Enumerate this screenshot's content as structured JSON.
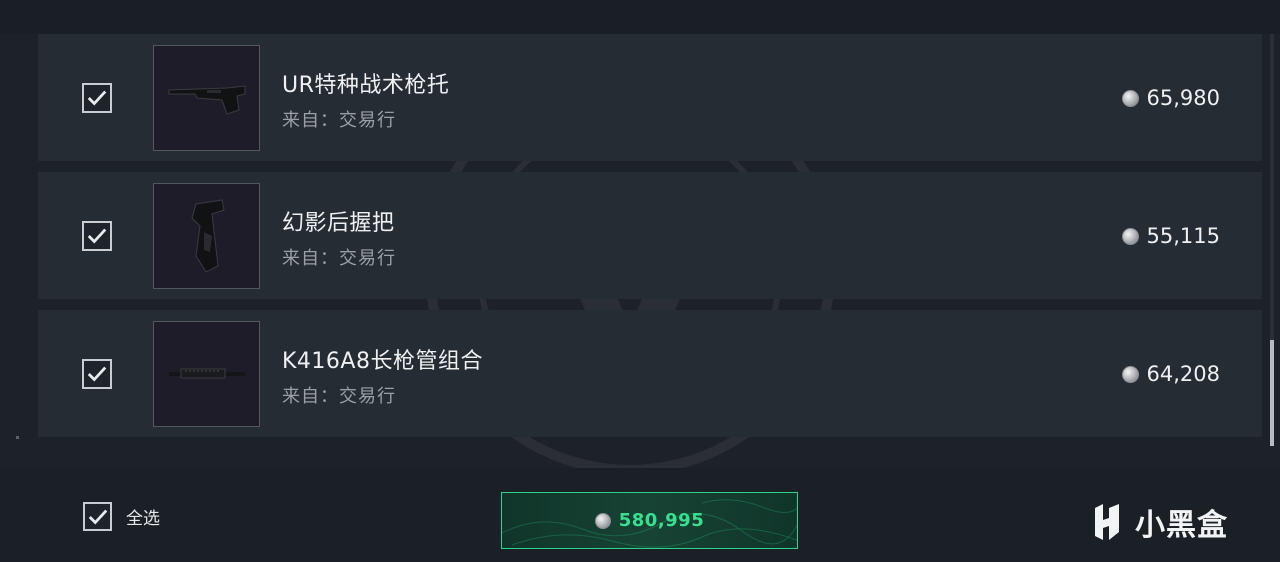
{
  "items": [
    {
      "name": "UR特种战术枪托",
      "source": "来自：交易行",
      "price": "65,980",
      "checked": true,
      "icon": "stock-icon"
    },
    {
      "name": "幻影后握把",
      "source": "来自：交易行",
      "price": "55,115",
      "checked": true,
      "icon": "grip-icon"
    },
    {
      "name": "K416A8长枪管组合",
      "source": "来自：交易行",
      "price": "64,208",
      "checked": true,
      "icon": "barrel-icon"
    }
  ],
  "footer": {
    "select_all_label": "全选",
    "select_all_checked": true,
    "total": "580,995"
  },
  "brand": {
    "logo_text": "小黑盒"
  },
  "colors": {
    "background": "#1d2228",
    "row": "#262c33",
    "accent_green": "#37e08f"
  }
}
